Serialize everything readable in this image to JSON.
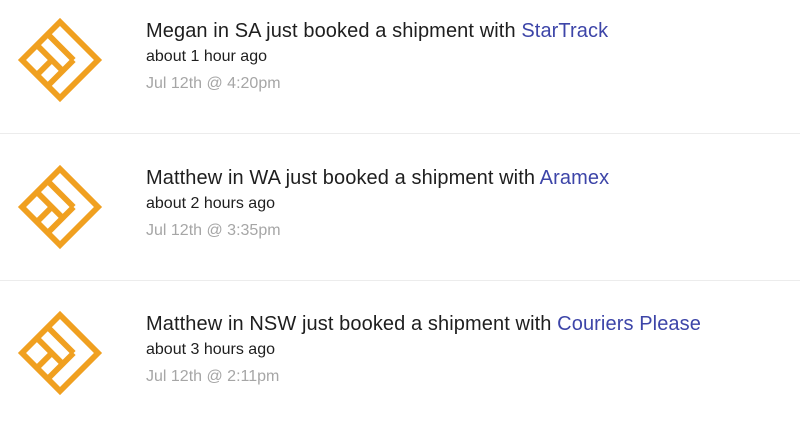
{
  "colors": {
    "brand_orange": "#f0a020",
    "link_blue": "#3d45a8",
    "text_dark": "#1e1e1e",
    "text_muted": "#a6a6a6",
    "divider": "#ececec"
  },
  "feed": {
    "items": [
      {
        "icon": "brand-logo-icon",
        "headline": "Megan in SA just booked a shipment with",
        "carrier": "StarTrack",
        "relative_time": "about 1 hour ago",
        "timestamp": "Jul 12th @ 4:20pm"
      },
      {
        "icon": "brand-logo-icon",
        "headline": "Matthew in WA just booked a shipment with",
        "carrier": "Aramex",
        "relative_time": "about 2 hours ago",
        "timestamp": "Jul 12th @ 3:35pm"
      },
      {
        "icon": "brand-logo-icon",
        "headline": "Matthew in NSW just booked a shipment with",
        "carrier": "Couriers Please",
        "relative_time": "about 3 hours ago",
        "timestamp": "Jul 12th @ 2:11pm"
      }
    ]
  }
}
